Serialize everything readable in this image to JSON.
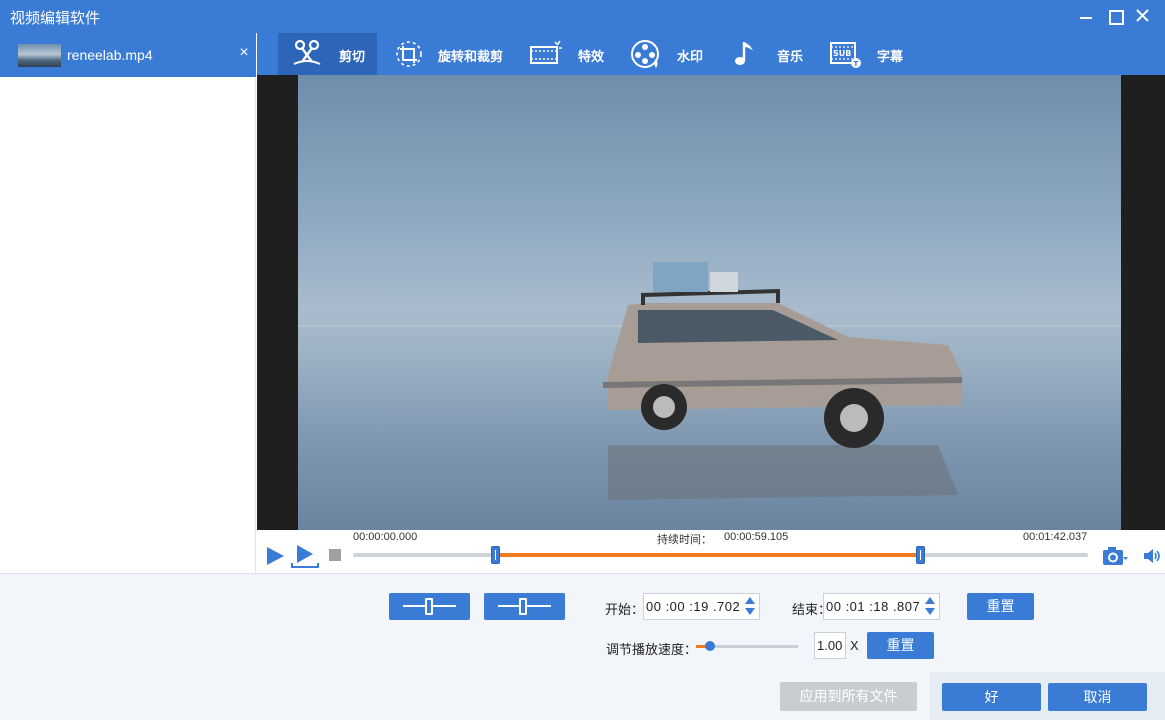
{
  "window": {
    "title": "视频编辑软件"
  },
  "sidebar": {
    "files": [
      {
        "name": "reneelab.mp4",
        "close": "×"
      }
    ]
  },
  "tabs": [
    {
      "label": "剪切",
      "icon": "scissors-icon",
      "active": true
    },
    {
      "label": "旋转和裁剪",
      "icon": "crop-rotate-icon",
      "active": false
    },
    {
      "label": "特效",
      "icon": "film-effects-icon",
      "active": false
    },
    {
      "label": "水印",
      "icon": "watermark-reel-icon",
      "active": false
    },
    {
      "label": "音乐",
      "icon": "music-note-icon",
      "active": false
    },
    {
      "label": "字幕",
      "icon": "subtitle-icon",
      "active": false
    }
  ],
  "timeline": {
    "start_time": "00:00:00.000",
    "duration_label": "持续时间：",
    "duration": "00:00:59.105",
    "end_time": "00:01:42.037",
    "selection_start_fraction": 0.193,
    "selection_end_fraction": 0.772
  },
  "trim": {
    "start_label": "开始：",
    "start_value": "00 :00 :19 .702",
    "end_label": "结束：",
    "end_value": "00 :01 :18 .807",
    "reset_label": "重置"
  },
  "speed": {
    "label": "调节播放速度：",
    "value": "1.00",
    "unit": "X",
    "reset_label": "重置",
    "slider_fraction": 0.14
  },
  "footer": {
    "apply_all_label": "应用到所有文件",
    "ok_label": "好",
    "cancel_label": "取消"
  },
  "colors": {
    "accent": "#3a7bd5",
    "accent_dark": "#2d66b8",
    "selection": "#f07c1f"
  }
}
